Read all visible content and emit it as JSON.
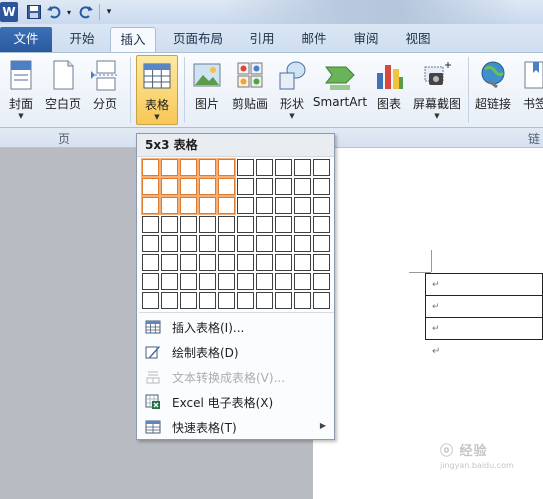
{
  "app": {
    "logo_letter": "W",
    "qat": {
      "undo_dropdown": "▾",
      "customize": "▾"
    }
  },
  "tabs": [
    "文件",
    "开始",
    "插入",
    "页面布局",
    "引用",
    "邮件",
    "审阅",
    "视图"
  ],
  "active_tab": "插入",
  "ribbon": {
    "buttons": [
      {
        "label": "封面",
        "icon": "cover-page-icon",
        "dropdown": "▼"
      },
      {
        "label": "空白页",
        "icon": "blank-page-icon",
        "dropdown": ""
      },
      {
        "label": "分页",
        "icon": "page-break-icon",
        "dropdown": ""
      },
      {
        "label": "表格",
        "icon": "table-icon",
        "dropdown": "▼"
      },
      {
        "label": "图片",
        "icon": "picture-icon",
        "dropdown": ""
      },
      {
        "label": "剪贴画",
        "icon": "clip-art-icon",
        "dropdown": ""
      },
      {
        "label": "形状",
        "icon": "shapes-icon",
        "dropdown": "▼"
      },
      {
        "label": "SmartArt",
        "icon": "smartart-icon",
        "dropdown": ""
      },
      {
        "label": "图表",
        "icon": "chart-icon",
        "dropdown": ""
      },
      {
        "label": "屏幕截图",
        "icon": "screenshot-icon",
        "dropdown": "▼"
      },
      {
        "label": "超链接",
        "icon": "hyperlink-icon",
        "dropdown": ""
      },
      {
        "label": "书签",
        "icon": "bookmark-icon",
        "dropdown": ""
      }
    ],
    "group_labels": {
      "pages": "页",
      "links": "链"
    }
  },
  "table_dropdown": {
    "header": "5x3 表格",
    "grid": {
      "cols": 10,
      "rows": 8,
      "selected_cols": 5,
      "selected_rows": 3
    },
    "items": [
      {
        "label": "插入表格(I)...",
        "icon": "insert-table-icon",
        "disabled": false,
        "submenu": ""
      },
      {
        "label": "绘制表格(D)",
        "icon": "draw-table-icon",
        "disabled": false,
        "submenu": ""
      },
      {
        "label": "文本转换成表格(V)...",
        "icon": "text-to-table-icon",
        "disabled": true,
        "submenu": ""
      },
      {
        "label": "Excel 电子表格(X)",
        "icon": "excel-spreadsheet-icon",
        "disabled": false,
        "submenu": ""
      },
      {
        "label": "快速表格(T)",
        "icon": "quick-tables-icon",
        "disabled": false,
        "submenu": "▶"
      }
    ]
  },
  "document": {
    "paragraph_mark": "↵",
    "table_rows": [
      "↵",
      "↵",
      "↵"
    ]
  },
  "watermark": {
    "text": "ⓞ 经验",
    "sub": "jingyan.baidu.com"
  },
  "colors": {
    "file_tab": "#2a5a9e",
    "pressed_button": "#f8c756",
    "grid_selected": "#e07a2c",
    "page": "#ffffff",
    "workspace": "#b8bcc2"
  }
}
